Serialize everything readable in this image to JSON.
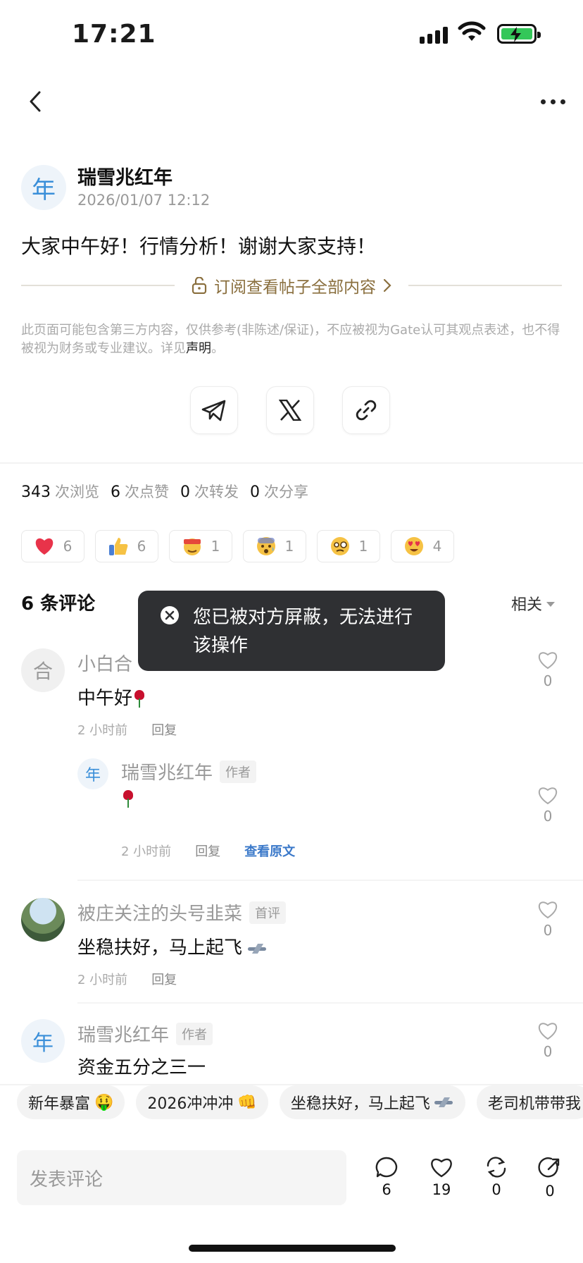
{
  "status_bar": {
    "time": "17:21"
  },
  "author": {
    "avatar_letter": "年",
    "name": "瑞雪兆红年",
    "date": "2026/01/07 12:12"
  },
  "post": {
    "text": "大家中午好！行情分析！谢谢大家支持！",
    "subscribe_label": "订阅查看帖子全部内容",
    "disclaimer": "此页面可能包含第三方内容，仅供参考(非陈述/保证)，不应被视为Gate认可其观点表述，也不得被视为财务或专业建议。详见",
    "disclaimer_link": "声明",
    "disclaimer_end": "。"
  },
  "share": {
    "icons": [
      "telegram-icon",
      "x-icon",
      "link-icon"
    ]
  },
  "stats": [
    {
      "num": "343",
      "label": "次浏览"
    },
    {
      "num": "6",
      "label": "次点赞"
    },
    {
      "num": "0",
      "label": "次转发"
    },
    {
      "num": "0",
      "label": "次分享"
    }
  ],
  "reactions": [
    {
      "emoji": "heart",
      "count": "6"
    },
    {
      "emoji": "thumbs-up",
      "count": "6"
    },
    {
      "emoji": "money-face",
      "count": "1"
    },
    {
      "emoji": "anxious-face",
      "count": "1"
    },
    {
      "emoji": "dizzy-face",
      "count": "1"
    },
    {
      "emoji": "heart-eyes",
      "count": "4"
    }
  ],
  "comments_header": {
    "title": "6 条评论",
    "sort": "相关"
  },
  "toast": {
    "text": "您已被对方屏蔽，无法进行该操作"
  },
  "comments": [
    {
      "avatar": "合",
      "name": "小白合",
      "text": "中午好",
      "time": "2 小时前",
      "reply": "回复",
      "likes": "0"
    },
    {
      "avatar": "年",
      "name": "瑞雪兆红年",
      "tag": "作者",
      "time": "2 小时前",
      "reply": "回复",
      "view_original": "查看原文",
      "likes": "0"
    },
    {
      "name": "被庄关注的头号韭菜",
      "tag": "首评",
      "text": "坐稳扶好，马上起飞",
      "time": "2 小时前",
      "reply": "回复",
      "likes": "0"
    },
    {
      "avatar": "年",
      "name": "瑞雪兆红年",
      "tag": "作者",
      "text": "资金五分之三一",
      "likes": "0"
    }
  ],
  "quick_replies": [
    {
      "label": "新年暴富",
      "emoji": "🤑"
    },
    {
      "label": "2026冲冲冲",
      "emoji": "👊"
    },
    {
      "label": "坐稳扶好，马上起飞",
      "emoji": "plane"
    },
    {
      "label": "老司机带带我"
    }
  ],
  "composer": {
    "placeholder": "发表评论"
  },
  "actions": [
    {
      "icon": "comment-icon",
      "count": "6"
    },
    {
      "icon": "heart-icon",
      "count": "19"
    },
    {
      "icon": "repost-icon",
      "count": "0"
    },
    {
      "icon": "share-icon",
      "count": "0"
    }
  ]
}
